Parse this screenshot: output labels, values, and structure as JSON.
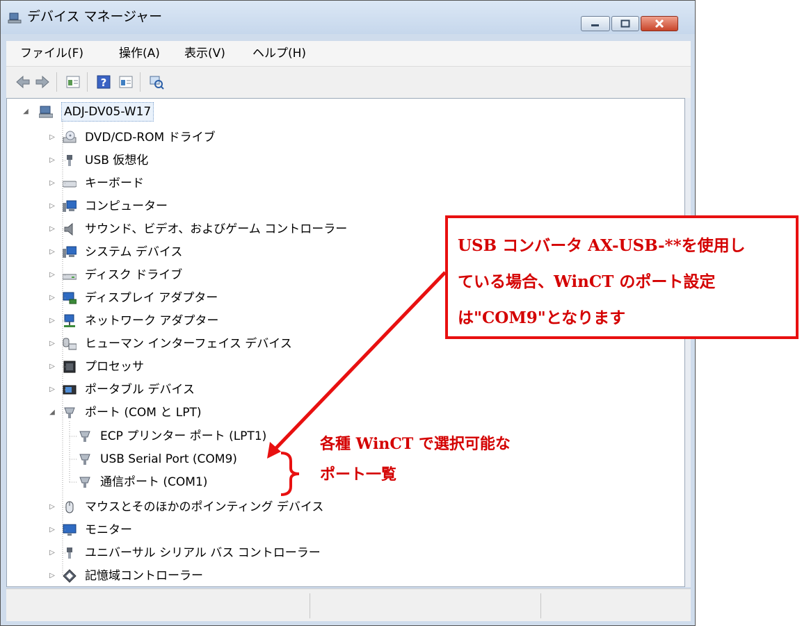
{
  "window": {
    "title": "デバイス マネージャー",
    "menu": [
      "ファイル(F)",
      "操作(A)",
      "表示(V)",
      "ヘルプ(H)"
    ]
  },
  "toolbar": {
    "icons": [
      "back-arrow-icon",
      "forward-arrow-icon",
      "properties-icon",
      "help-icon",
      "update-driver-icon",
      "scan-hardware-icon"
    ]
  },
  "tree": {
    "root": "ADJ-DV05-W17",
    "categories": [
      "DVD/CD-ROM ドライブ",
      "USB 仮想化",
      "キーボード",
      "コンピューター",
      "サウンド、ビデオ、およびゲーム コントローラー",
      "システム デバイス",
      "ディスク ドライブ",
      "ディスプレイ アダプター",
      "ネットワーク アダプター",
      "ヒューマン インターフェイス デバイス",
      "プロセッサ",
      "ポータブル デバイス",
      "ポート (COM と LPT)",
      "マウスとそのほかのポインティング デバイス",
      "モニター",
      "ユニバーサル シリアル バス コントローラー",
      "記憶域コントローラー"
    ],
    "ports": [
      "ECP プリンター ポート (LPT1)",
      "USB Serial Port (COM9)",
      "通信ポート (COM1)"
    ]
  },
  "annotations": {
    "callout_lines": [
      "USB コンバータ AX-USB-**を使用し",
      "ている場合、WinCT のポート設定",
      "は\"COM9\"となります"
    ],
    "bracket_label_lines": [
      "各種 WinCT で選択可能な",
      "ポート一覧"
    ],
    "color": "#e81010"
  }
}
